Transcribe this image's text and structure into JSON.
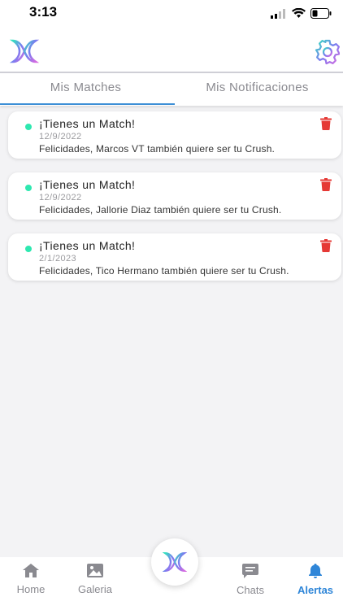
{
  "status_bar": {
    "time": "3:13"
  },
  "header": {
    "logo_icon": "butterfly-logo-icon",
    "settings_icon": "gear-icon"
  },
  "tabs": [
    {
      "label": "Mis Matches",
      "active": true
    },
    {
      "label": "Mis Notificaciones",
      "active": false
    }
  ],
  "notifications": [
    {
      "title": "¡Tienes un Match!",
      "date": "12/9/2022",
      "message": "Felicidades, Marcos VT también quiere ser tu Crush."
    },
    {
      "title": "¡Tienes un Match!",
      "date": "12/9/2022",
      "message": "Felicidades, Jallorie Diaz también quiere ser tu Crush."
    },
    {
      "title": "¡Tienes un Match!",
      "date": "2/1/2023",
      "message": "Felicidades, Tico Hermano también quiere ser tu Crush."
    }
  ],
  "bottom_nav": [
    {
      "label": "Home",
      "icon": "home-icon"
    },
    {
      "label": "Galeria",
      "icon": "image-icon"
    },
    {
      "label": "Chats",
      "icon": "chat-icon"
    },
    {
      "label": "Alertas",
      "icon": "bell-icon",
      "active": true
    }
  ],
  "colors": {
    "accent_blue": "#3d8fd6",
    "active_nav": "#2f86d8",
    "unread_dot": "#2ee8b0",
    "delete_red": "#e53935",
    "logo_gradient": [
      "#35e0c0",
      "#7a7cf0",
      "#d56be0"
    ]
  }
}
